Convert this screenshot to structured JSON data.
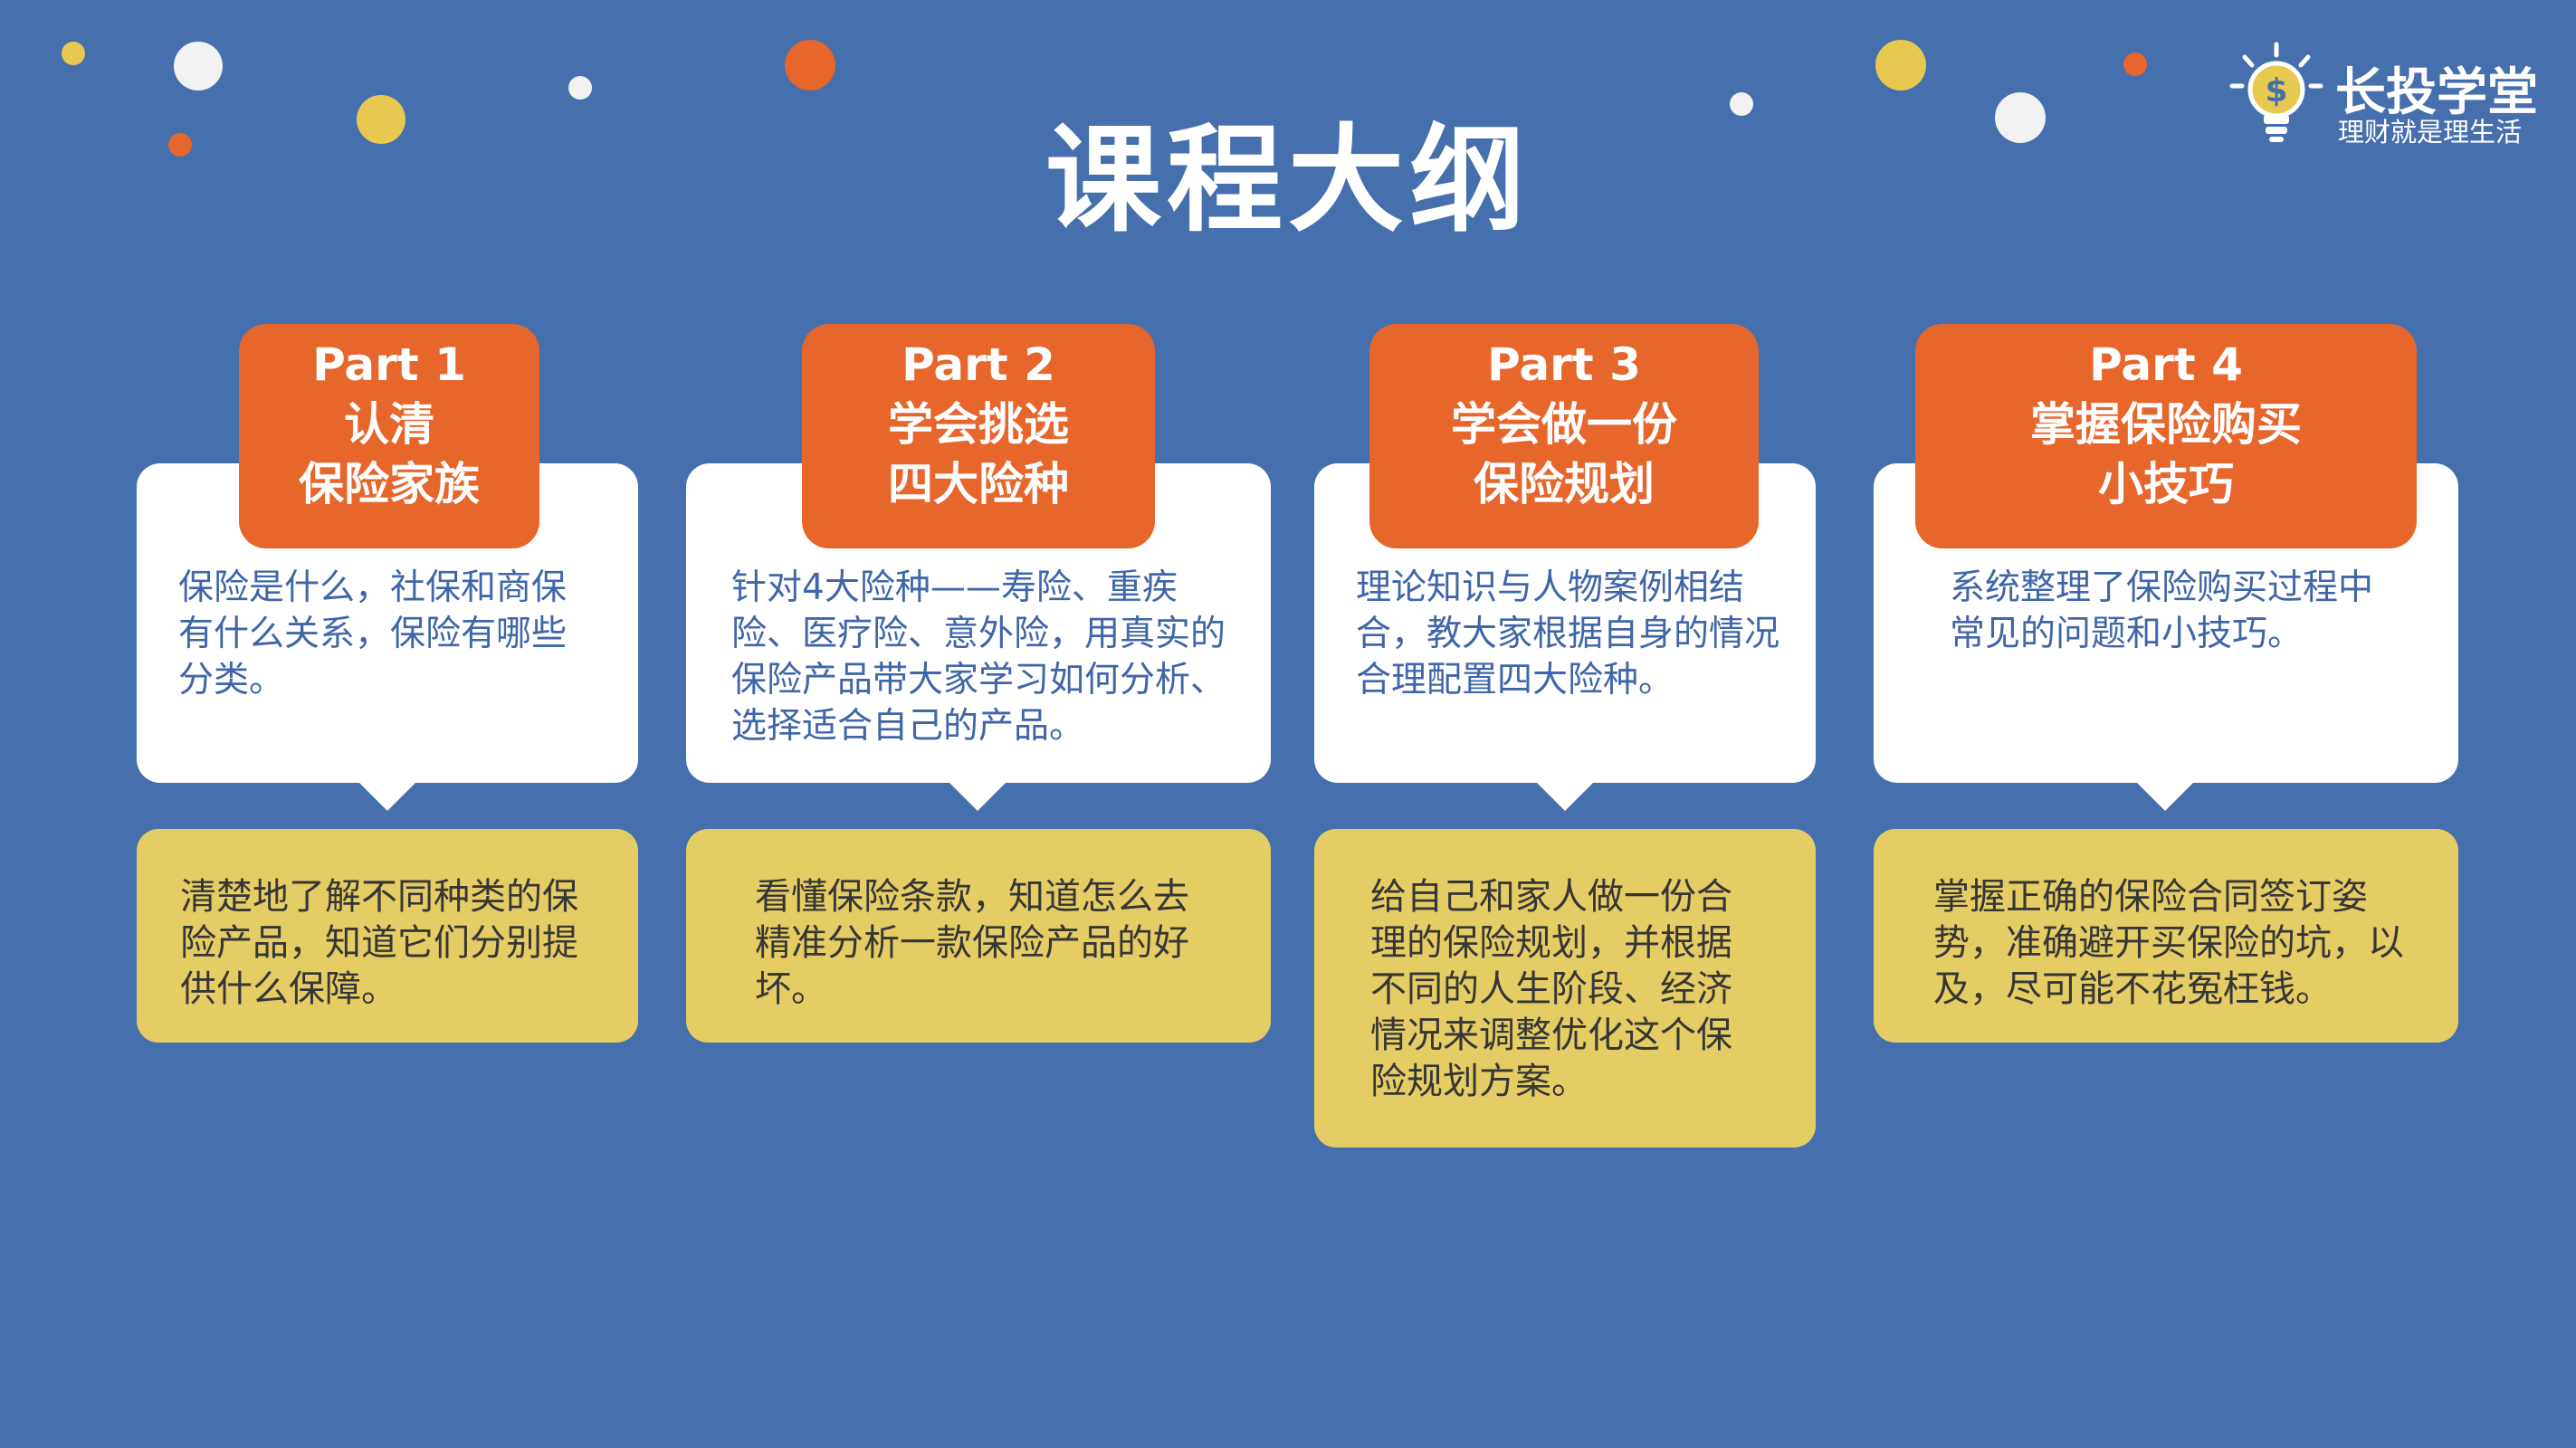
{
  "header": {
    "title": "课程大纲"
  },
  "brand": {
    "name": "长投学堂",
    "slogan": "理财就是理生活",
    "icon": "lightbulb-dollar-icon"
  },
  "colors": {
    "background": "#4670ad",
    "tag": "#e6662c",
    "card_white": "#ffffff",
    "card_yellow": "#e4cd64",
    "desc_text": "#3f66a8",
    "goal_text": "#363636"
  },
  "parts": [
    {
      "tag_line1": "Part 1",
      "tag_line2": "认清\n保险家族",
      "description": "保险是什么，社保和商保有什么关系，保险有哪些分类。",
      "goal": "清楚地了解不同种类的保险产品，知道它们分别提供什么保障。"
    },
    {
      "tag_line1": "Part 2",
      "tag_line2": "学会挑选\n四大险种",
      "description": "针对4大险种——寿险、重疾险、医疗险、意外险，用真实的保险产品带大家学习如何分析、选择适合自己的产品。",
      "goal": "看懂保险条款，知道怎么去精准分析一款保险产品的好坏。"
    },
    {
      "tag_line1": "Part 3",
      "tag_line2": "学会做一份\n保险规划",
      "description": "理论知识与人物案例相结合，教大家根据自身的情况合理配置四大险种。",
      "goal": "给自己和家人做一份合理的保险规划，并根据不同的人生阶段、经济情况来调整优化这个保险规划方案。"
    },
    {
      "tag_line1": "Part 4",
      "tag_line2": "掌握保险购买\n小技巧",
      "description": "系统整理了保险购买过程中常见的问题和小技巧。",
      "goal": "掌握正确的保险合同签订姿势，准确避开买保险的坑，以及，尽可能不花冤枉钱。"
    }
  ]
}
